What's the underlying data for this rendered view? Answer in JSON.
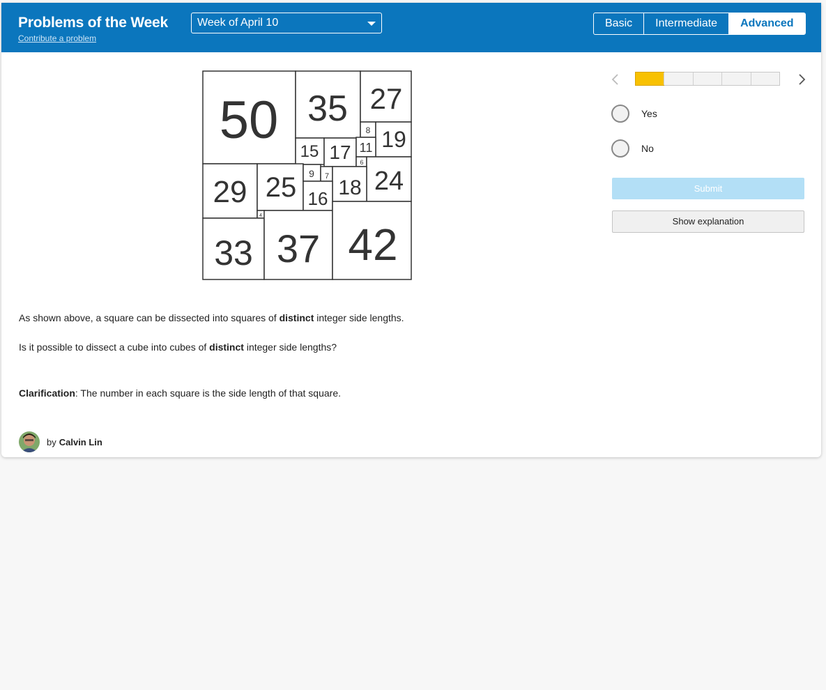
{
  "header": {
    "title": "Problems of the Week",
    "contribute_link": "Contribute a problem",
    "week_select": {
      "selected": "Week of April 10"
    },
    "levels": [
      {
        "label": "Basic",
        "active": false
      },
      {
        "label": "Intermediate",
        "active": false
      },
      {
        "label": "Advanced",
        "active": true
      }
    ]
  },
  "figure": {
    "squares": [
      {
        "size": 50
      },
      {
        "size": 35
      },
      {
        "size": 27
      },
      {
        "size": 8
      },
      {
        "size": 19
      },
      {
        "size": 15
      },
      {
        "size": 17
      },
      {
        "size": 11
      },
      {
        "size": 6
      },
      {
        "size": 9
      },
      {
        "size": 7
      },
      {
        "size": 18
      },
      {
        "size": 24
      },
      {
        "size": 29
      },
      {
        "size": 25
      },
      {
        "size": 16
      },
      {
        "size": 4
      },
      {
        "size": 33
      },
      {
        "size": 37
      },
      {
        "size": 42
      }
    ]
  },
  "problem": {
    "line1": {
      "before": "As shown above, a square can be dissected into squares of ",
      "bold": "distinct",
      "after": " integer side lengths."
    },
    "line2": {
      "before": "Is it possible to dissect a cube into cubes of ",
      "bold": "distinct",
      "after": " integer side lengths?"
    },
    "clarification": {
      "bold": "Clarification",
      "after": ": The number in each square is the side length of that square."
    }
  },
  "author": {
    "by": "by",
    "name": "Calvin Lin"
  },
  "sidebar": {
    "progress": {
      "total": 5,
      "current": 1
    },
    "options": [
      {
        "label": "Yes"
      },
      {
        "label": "No"
      }
    ],
    "submit_label": "Submit",
    "explanation_label": "Show explanation"
  },
  "colors": {
    "header": "#0b76bd",
    "progress_current": "#f8c102",
    "submit_disabled": "#b3dff6"
  },
  "icons": {
    "prev": "chevron-left-icon",
    "next": "chevron-right-icon",
    "dropdown": "caret-down-icon"
  }
}
